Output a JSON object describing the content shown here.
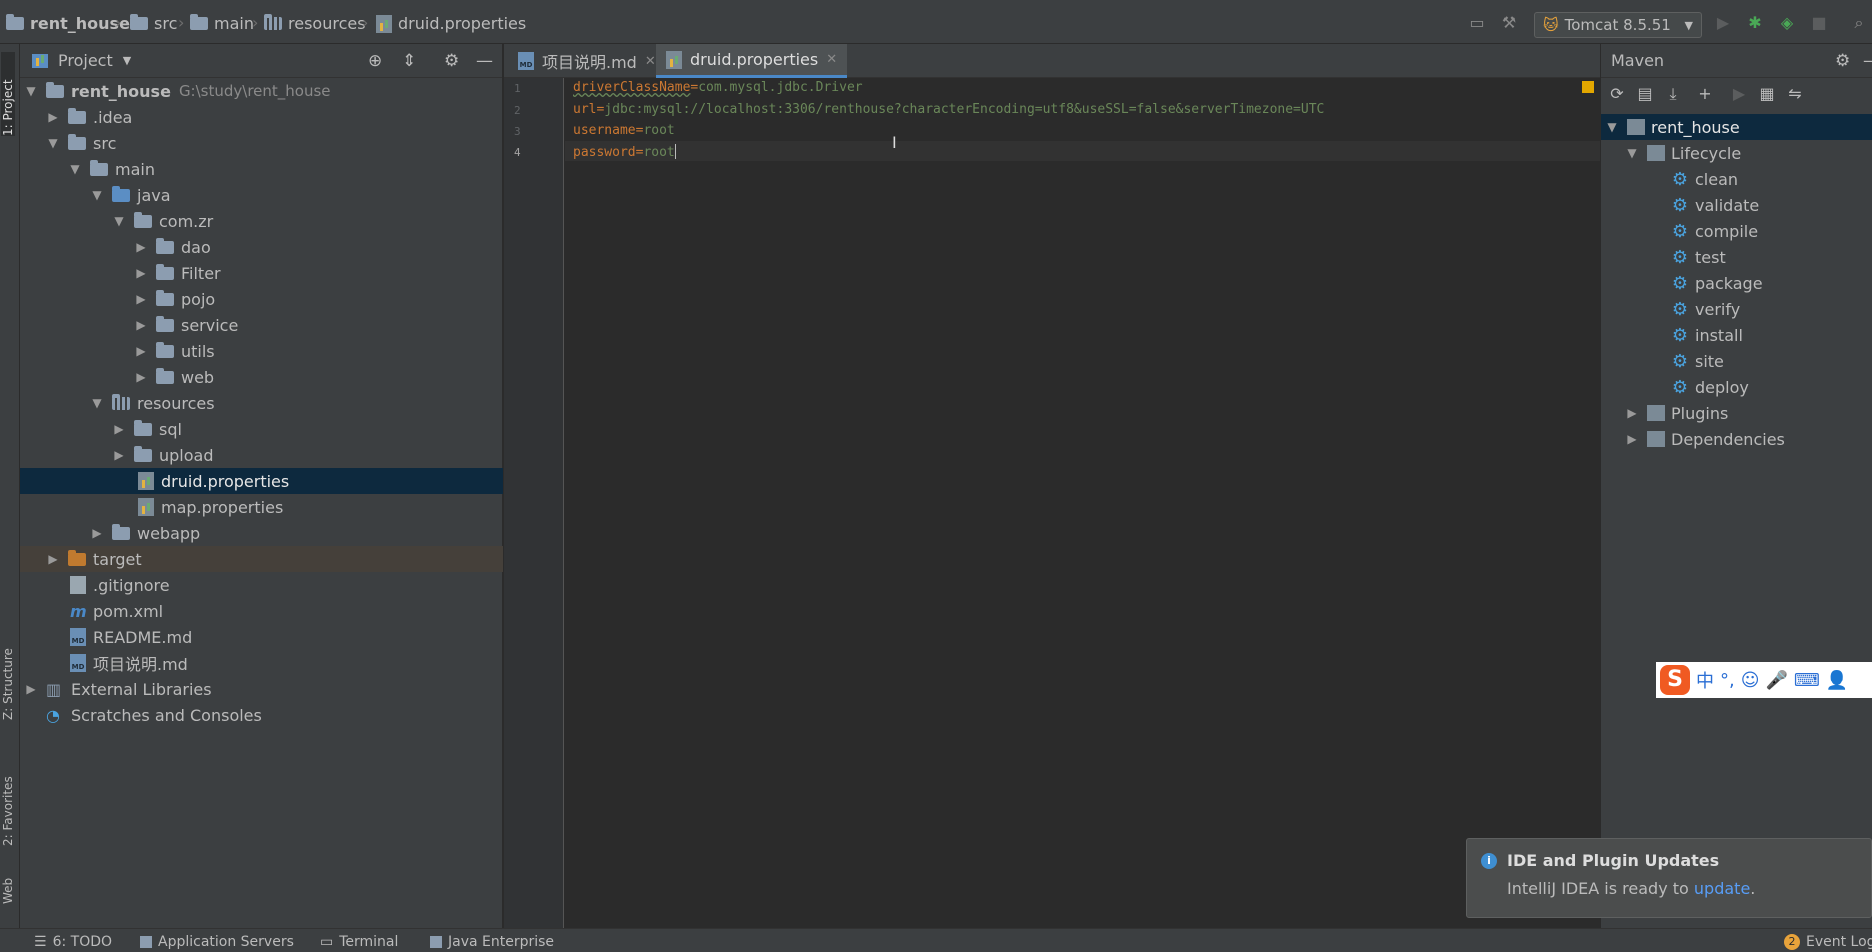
{
  "navbar": {
    "breadcrumbs": [
      "rent_house",
      "src",
      "main",
      "resources",
      "druid.properties"
    ],
    "run_config": "Tomcat 8.5.51"
  },
  "project_panel": {
    "title": "Project",
    "tree": [
      {
        "label": "rent_house",
        "hint": "G:\\study\\rent_house"
      },
      {
        "label": ".idea"
      },
      {
        "label": "src"
      },
      {
        "label": "main"
      },
      {
        "label": "java"
      },
      {
        "label": "com.zr"
      },
      {
        "label": "dao"
      },
      {
        "label": "Filter"
      },
      {
        "label": "pojo"
      },
      {
        "label": "service"
      },
      {
        "label": "utils"
      },
      {
        "label": "web"
      },
      {
        "label": "resources"
      },
      {
        "label": "sql"
      },
      {
        "label": "upload"
      },
      {
        "label": "druid.properties"
      },
      {
        "label": "map.properties"
      },
      {
        "label": "webapp"
      },
      {
        "label": "target"
      },
      {
        "label": ".gitignore"
      },
      {
        "label": "pom.xml"
      },
      {
        "label": "README.md"
      },
      {
        "label": "项目说明.md"
      },
      {
        "label": "External Libraries"
      },
      {
        "label": "Scratches and Consoles"
      }
    ]
  },
  "side_tabs": {
    "project": "1: Project",
    "structure": "Z: Structure",
    "favorites": "2: Favorites",
    "web": "Web"
  },
  "editor": {
    "tabs": [
      {
        "label": "项目说明.md"
      },
      {
        "label": "druid.properties"
      }
    ],
    "lines": [
      {
        "num": "1",
        "key": "driverClassName",
        "value": "com.mysql.jdbc.Driver"
      },
      {
        "num": "2",
        "key": "url",
        "value": "jdbc:mysql://localhost:3306/renthouse?characterEncoding=utf8&useSSL=false&serverTimezone=UTC"
      },
      {
        "num": "3",
        "key": "username",
        "value": "root"
      },
      {
        "num": "4",
        "key": "password",
        "value": "root"
      }
    ]
  },
  "maven": {
    "title": "Maven",
    "project": "rent_house",
    "lifecycle_label": "Lifecycle",
    "lifecycle": [
      "clean",
      "validate",
      "compile",
      "test",
      "package",
      "verify",
      "install",
      "site",
      "deploy"
    ],
    "plugins_label": "Plugins",
    "dependencies_label": "Dependencies"
  },
  "notification": {
    "title": "IDE and Plugin Updates",
    "body": "IntelliJ IDEA is ready to",
    "link": "update",
    "suffix": "."
  },
  "ime": {
    "lang": "中"
  },
  "bottom_bar": {
    "todo": "6: TODO",
    "app_servers": "Application Servers",
    "terminal": "Terminal",
    "java_ee": "Java Enterprise",
    "event_count": "2",
    "event_log": "Event Log"
  },
  "colors": {
    "accent": "#4a88c7",
    "selection": "#0d293e",
    "key": "#cc7832",
    "value": "#6a8759"
  }
}
